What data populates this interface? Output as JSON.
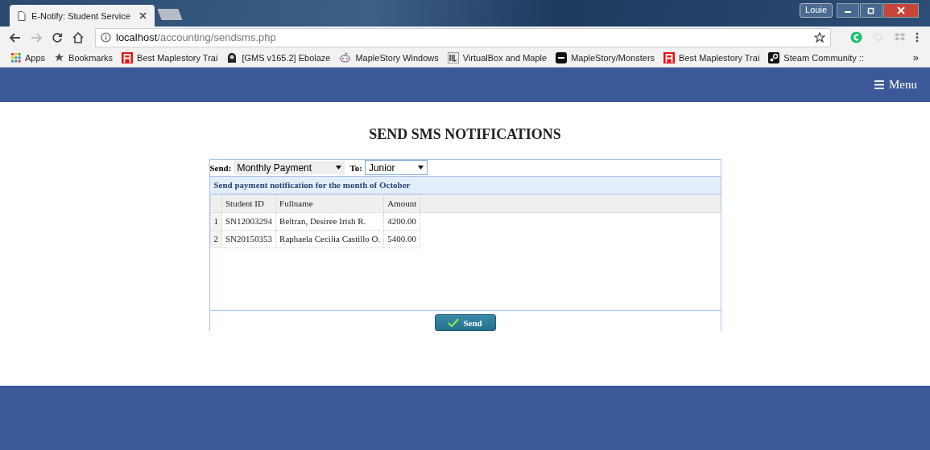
{
  "browser": {
    "tab_title": "E-Notify: Student Service",
    "address_host": "localhost",
    "address_path": "/accounting/sendsms.php",
    "user": "Louie",
    "bookmarks": [
      {
        "kind": "apps",
        "label": "Apps"
      },
      {
        "kind": "star",
        "label": "Bookmarks"
      },
      {
        "kind": "reda",
        "label": "Best Maplestory Trai"
      },
      {
        "kind": "figure",
        "label": "[GMS v165.2] Ebolaze"
      },
      {
        "kind": "robot",
        "label": "MapleStory Windows"
      },
      {
        "kind": "mark",
        "label": "VirtualBox and Maple"
      },
      {
        "kind": "sw",
        "label": "MapleStory/Monsters"
      },
      {
        "kind": "reda",
        "label": "Best Maplestory Trai"
      },
      {
        "kind": "steam",
        "label": "Steam Community ::"
      }
    ],
    "more": "»"
  },
  "header": {
    "menu": "Menu"
  },
  "title": "SEND SMS NOTIFICATIONS",
  "form": {
    "send_label": "Send:",
    "send_value": "Monthly Payment",
    "to_label": "To:",
    "to_value": "Junior"
  },
  "table": {
    "caption": "Send payment notification for the month of October",
    "columns": [
      "Student ID",
      "Fullname",
      "Amount"
    ],
    "rows": [
      {
        "number": "1",
        "student_id": "SN12003294",
        "fullname": "Beltran, Desiree Irish R.",
        "amount": "4200.00"
      },
      {
        "number": "2",
        "student_id": "SN20150353",
        "fullname": "Raphaela Cecilia Castillo O.",
        "amount": "5400.00"
      }
    ]
  },
  "button": "Send"
}
